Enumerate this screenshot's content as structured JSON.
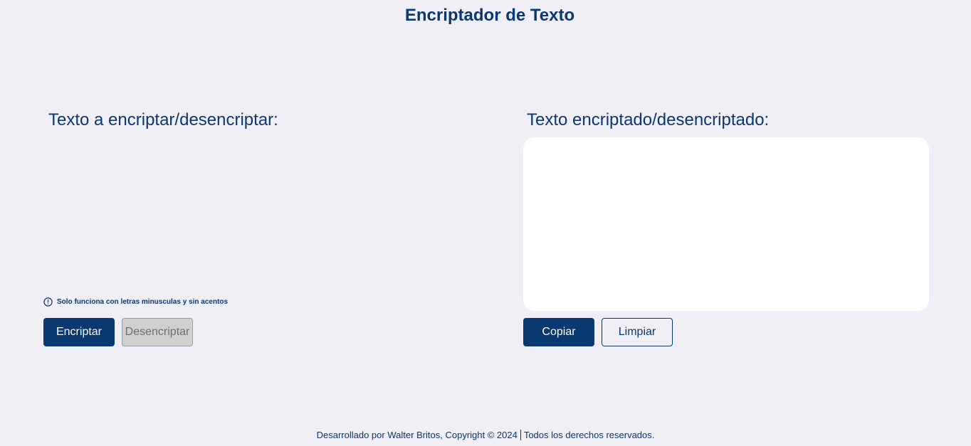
{
  "header": {
    "title": "Encriptador de Texto"
  },
  "input_panel": {
    "label": "Texto a encriptar/desencriptar:",
    "value": "",
    "notice": "Solo funciona con letras minusculas y sin acentos",
    "notice_icon": "info-circle-icon",
    "encrypt_label": "Encriptar",
    "decrypt_label": "Desencriptar"
  },
  "output_panel": {
    "label": "Texto encriptado/desencriptado:",
    "value": "",
    "copy_label": "Copiar",
    "clear_label": "Limpiar"
  },
  "footer": {
    "text_left": "Desarrollado por Walter Britos, Copyright © 2024",
    "text_right": "Todos los derechos reservados."
  },
  "colors": {
    "accent": "#0a3871",
    "background": "#efeff5",
    "disabled_bg": "#d0d0d0",
    "output_bg": "#ffffff"
  }
}
